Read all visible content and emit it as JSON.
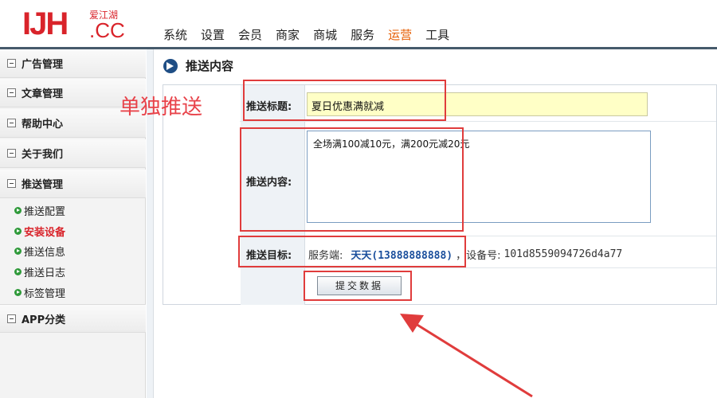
{
  "header": {
    "logo_main": "IJH",
    "logo_cn": "爱江湖",
    "logo_suffix": ".CC",
    "nav": [
      "系统",
      "设置",
      "会员",
      "商家",
      "商城",
      "服务",
      "运营",
      "工具"
    ],
    "active_nav_index": 6
  },
  "sidebar": {
    "groups": [
      "广告管理",
      "文章管理",
      "帮助中心",
      "关于我们",
      "推送管理",
      "APP分类"
    ],
    "sub_items": [
      "推送配置",
      "安装设备",
      "推送信息",
      "推送日志",
      "标签管理"
    ],
    "active_sub_index": 1
  },
  "main": {
    "title": "推送内容",
    "fields": {
      "title_label": "推送标题:",
      "title_value": "夏日优惠满就减",
      "content_label": "推送内容:",
      "content_value": "全场满100减10元，满200元减20元",
      "target_label": "推送目标:",
      "target_prefix": "服务端:",
      "target_name": "天天(13888888888)",
      "target_device_prefix": "，设备号:",
      "target_device_id": "101d8559094726d4a77"
    },
    "submit_label": "提交数据"
  },
  "annotations": {
    "note_text": "单独推送",
    "color": "#e03c3c"
  }
}
